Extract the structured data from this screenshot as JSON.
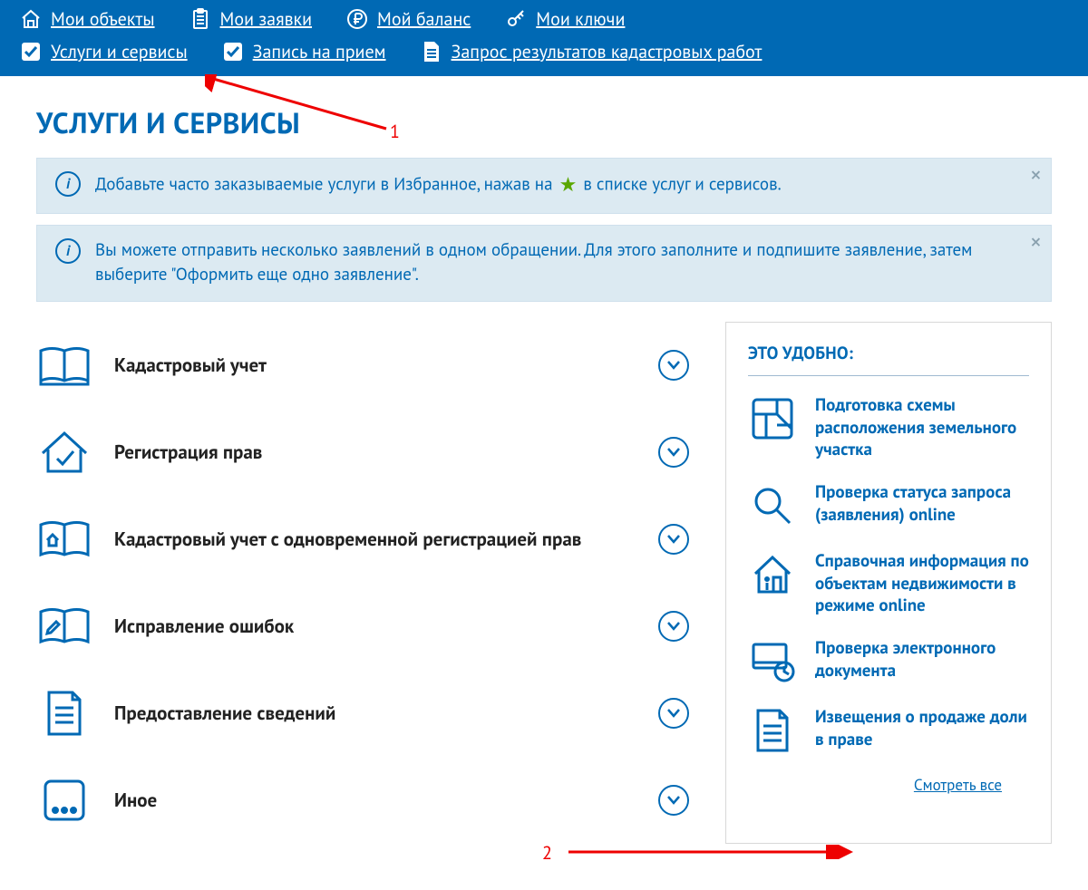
{
  "nav": {
    "row1": [
      {
        "label": "Мои объекты",
        "icon": "home"
      },
      {
        "label": "Мои заявки",
        "icon": "doc"
      },
      {
        "label": "Мой баланс",
        "icon": "ruble"
      },
      {
        "label": "Мои ключи",
        "icon": "key"
      }
    ],
    "row2": [
      {
        "label": "Услуги и сервисы",
        "icon": "check"
      },
      {
        "label": "Запись на прием",
        "icon": "check"
      },
      {
        "label": "Запрос результатов кадастровых работ",
        "icon": "file"
      }
    ]
  },
  "page_title": "УСЛУГИ И СЕРВИСЫ",
  "info1_before": "Добавьте часто заказываемые услуги в Избранное, нажав на ",
  "info1_after": " в списке услуг и сервисов.",
  "info2": "Вы можете отправить несколько заявлений в одном обращении. Для этого заполните и подпишите заявление, затем выберите \"Оформить еще одно заявление\".",
  "categories": [
    "Кадастровый учет",
    "Регистрация прав",
    "Кадастровый учет с одновременной регистрацией прав",
    "Исправление ошибок",
    "Предоставление сведений",
    "Иное"
  ],
  "side_title": "ЭТО УДОБНО:",
  "side_items": [
    "Подготовка схемы расположения земельного участка",
    "Проверка статуса запроса (заявления) online",
    "Справочная информация по объектам недвижимости в режиме online",
    "Проверка электронного документа",
    "Извещения о продаже доли в праве"
  ],
  "see_all": "Смотреть все",
  "anno": {
    "label1": "1",
    "label2": "2"
  }
}
